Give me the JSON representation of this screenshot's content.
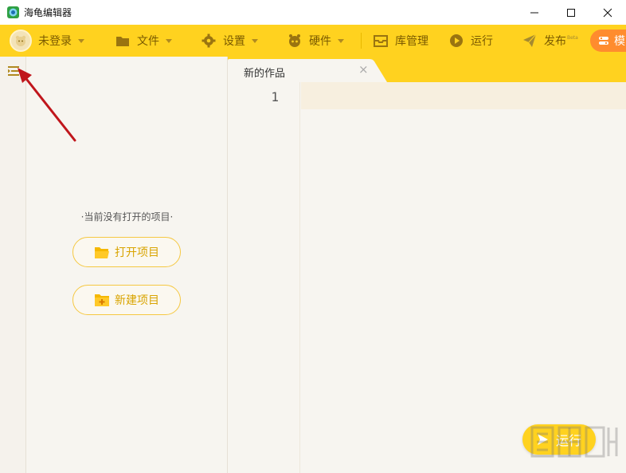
{
  "window": {
    "title": "海龟编辑器"
  },
  "toolbar": {
    "login": "未登录",
    "file": "文件",
    "settings": "设置",
    "hardware": "硬件",
    "library": "库管理",
    "run": "运行",
    "publish": "发布",
    "publish_sup": "Beta",
    "more": "模"
  },
  "project_panel": {
    "empty_text": "·当前没有打开的项目·",
    "open_button": "打开项目",
    "new_button": "新建项目"
  },
  "tabs": [
    {
      "label": "新的作品",
      "close": "×"
    }
  ],
  "editor": {
    "line_numbers": [
      "1"
    ]
  },
  "run_button": {
    "label": "运行"
  },
  "colors": {
    "accent": "#ffd21f",
    "toolbar_text": "#7a5a00",
    "panel_bg": "#f7f5f0",
    "button_border": "#f5c842",
    "more_button": "#ff8c2e",
    "annotation": "#c0161c"
  },
  "icons": {
    "app": "turtle-app-icon",
    "minimize": "minimize-icon",
    "maximize": "maximize-icon",
    "close": "close-icon",
    "folder": "folder-icon",
    "gear": "gear-icon",
    "hardware": "robot-icon",
    "library": "inbox-icon",
    "run": "play-icon",
    "publish": "paper-plane-icon",
    "menu": "menu-toggle-icon"
  }
}
